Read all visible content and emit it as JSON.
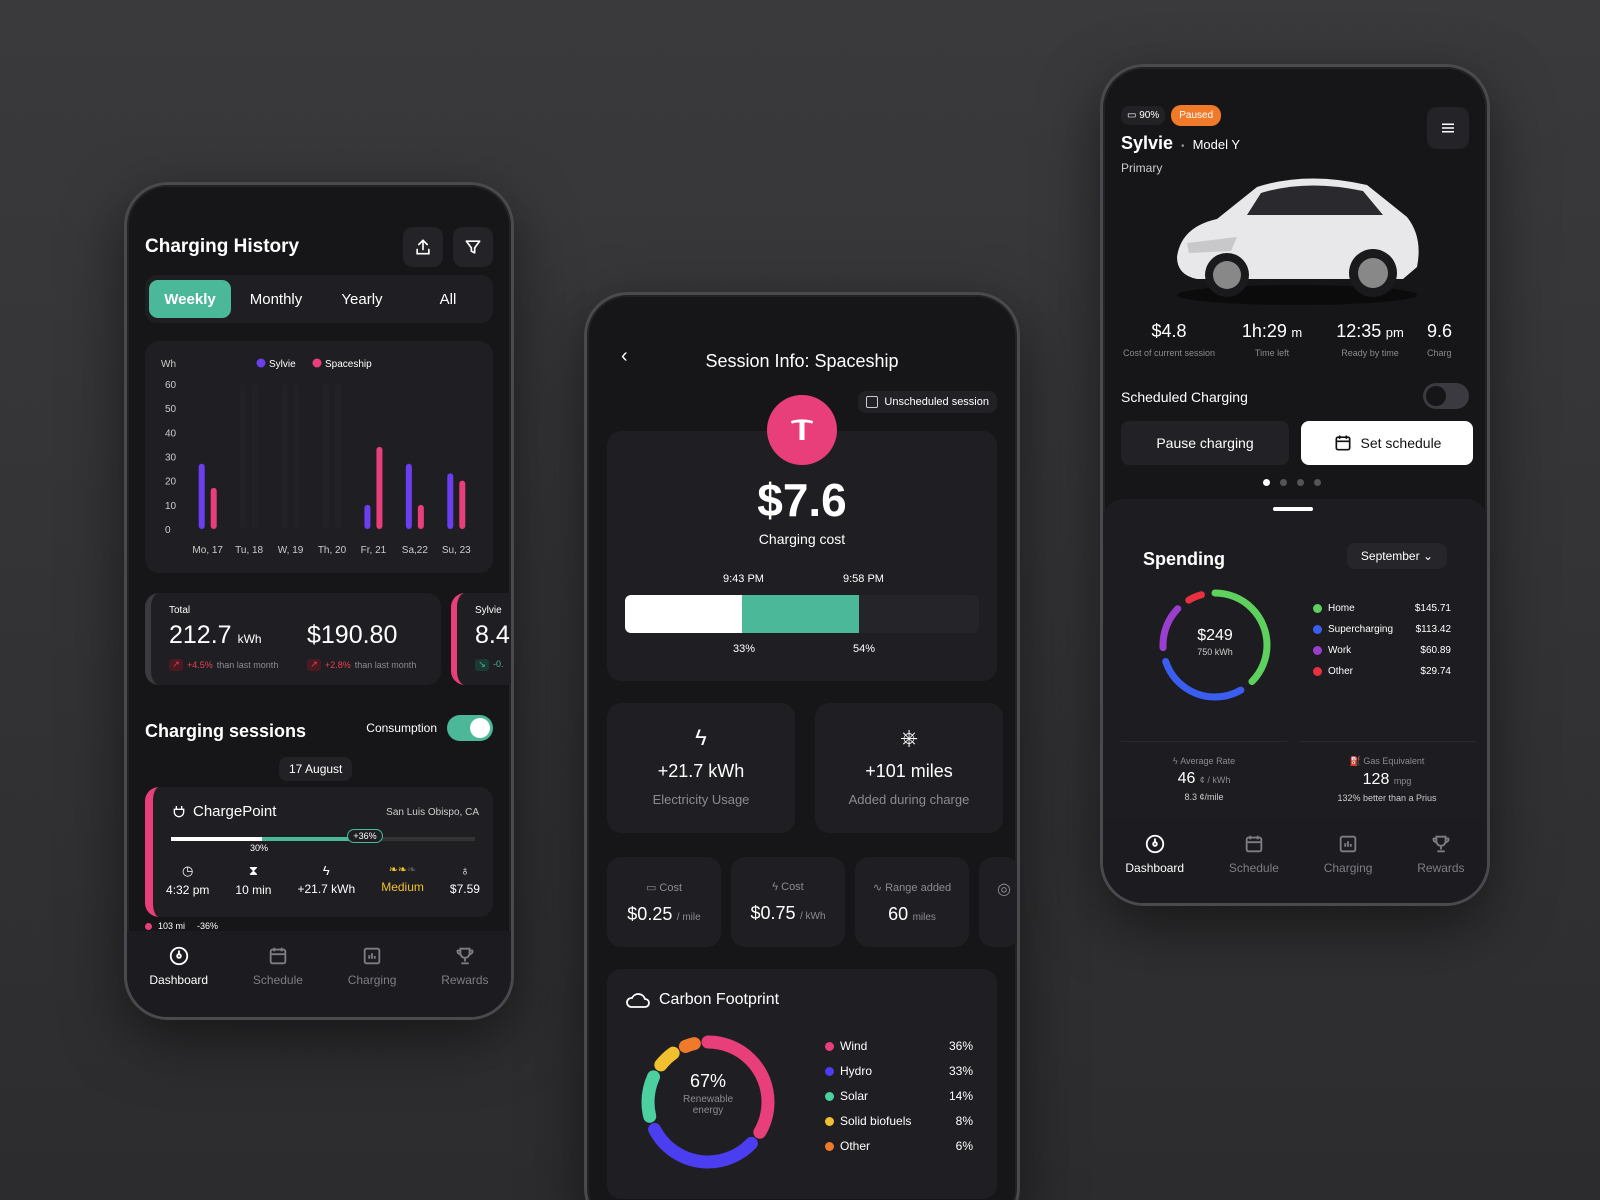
{
  "colors": {
    "accent": "#4cb89a",
    "pink": "#e83e7a",
    "purple": "#6b3ef0",
    "orange": "#f07a2a",
    "bg": "#161618"
  },
  "left": {
    "title": "Charging History",
    "tabs": [
      "Weekly",
      "Monthly",
      "Yearly",
      "All"
    ],
    "chart_data": {
      "type": "bar",
      "unit_label": "Wh",
      "legend": [
        "Sylvie",
        "Spaceship"
      ],
      "y_ticks": [
        "60",
        "50",
        "40",
        "30",
        "20",
        "10",
        "0"
      ],
      "categories": [
        "Mo, 17",
        "Tu, 18",
        "W, 19",
        "Th, 20",
        "Fr, 21",
        "Sa,22",
        "Su, 23"
      ],
      "ylim": [
        0,
        60
      ],
      "series": [
        {
          "name": "Sylvie",
          "color": "#6b3ef0",
          "values": [
            27,
            0,
            0,
            0,
            10,
            27,
            23
          ]
        },
        {
          "name": "Spaceship",
          "color": "#e83e7a",
          "values": [
            17,
            0,
            0,
            0,
            34,
            10,
            20
          ]
        }
      ]
    },
    "stats": {
      "total_label": "Total",
      "kwh": "212.7",
      "kwh_unit": "kWh",
      "kwh_change": "+4.5%",
      "kwh_change_text": "than last month",
      "cost": "$190.80",
      "cost_change": "+2.8%",
      "cost_change_text": "than last month",
      "side_label": "Sylvie",
      "side_value": "8.4",
      "side_change": "-0."
    },
    "sessions_title": "Charging sessions",
    "consumption_label": "Consumption",
    "date_chip": "17 August",
    "session": {
      "name": "ChargePoint",
      "location": "San Luis Obispo, CA",
      "progress_start_label": "30%",
      "progress_badge": "+36%",
      "progress_start": 0.3,
      "progress_end": 0.66,
      "time": "4:32 pm",
      "duration": "10 min",
      "energy": "+21.7 kWh",
      "level": "Medium",
      "cost": "$7.59"
    },
    "footer": {
      "miles": "103 mi",
      "pct": "-36%"
    },
    "nav": [
      "Dashboard",
      "Schedule",
      "Charging",
      "Rewards"
    ]
  },
  "middle": {
    "title": "Session Info: Spaceship",
    "chip": "Unscheduled session",
    "cost": "$7.6",
    "cost_label": "Charging cost",
    "time_start": "9:43 PM",
    "time_end": "9:58 PM",
    "pct_start": "33%",
    "pct_end": "54%",
    "usage": {
      "value": "+21.7 kWh",
      "label": "Electricity Usage"
    },
    "miles": {
      "value": "+101 miles",
      "label": "Added during charge"
    },
    "mini": [
      {
        "label": "Cost",
        "value": "$0.25",
        "unit": "/ mile"
      },
      {
        "label": "Cost",
        "value": "$0.75",
        "unit": "/ kWh"
      },
      {
        "label": "Range added",
        "value": "60",
        "unit": "miles"
      }
    ],
    "carbon": {
      "title": "Carbon Footprint",
      "center_value": "67%",
      "center_label": "Renewable energy",
      "items": [
        {
          "name": "Wind",
          "pct": "36%",
          "color": "#e83e7a",
          "value": 36
        },
        {
          "name": "Hydro",
          "pct": "33%",
          "color": "#4a3ef0",
          "value": 33
        },
        {
          "name": "Solar",
          "pct": "14%",
          "color": "#4cd0a0",
          "value": 14
        },
        {
          "name": "Solid biofuels",
          "pct": "8%",
          "color": "#f0c030",
          "value": 8
        },
        {
          "name": "Other",
          "pct": "6%",
          "color": "#f07a2a",
          "value": 6
        }
      ]
    }
  },
  "right": {
    "battery": "90%",
    "status": "Paused",
    "car_name": "Sylvie",
    "model": "Model Y",
    "role": "Primary",
    "stats": [
      {
        "value": "$4.8",
        "unit": "",
        "label": "Cost of current session"
      },
      {
        "value": "1h:29",
        "unit": "m",
        "label": "Time left"
      },
      {
        "value": "12:35",
        "unit": "pm",
        "label": "Ready by time"
      },
      {
        "value": "9.6",
        "unit": "",
        "label": "Charg"
      }
    ],
    "scheduled_label": "Scheduled Charging",
    "pause_label": "Pause charging",
    "schedule_label": "Set schedule",
    "spending_title": "Spending",
    "month": "September",
    "total": "$249",
    "total_kwh": "750 kWh",
    "spend": [
      {
        "name": "Home",
        "value": "$145.71",
        "color": "#5ed05e",
        "amount": 145.71
      },
      {
        "name": "Supercharging",
        "value": "$113.42",
        "color": "#3a5ef0",
        "amount": 113.42
      },
      {
        "name": "Work",
        "value": "$60.89",
        "color": "#9a3ed0",
        "amount": 60.89
      },
      {
        "name": "Other",
        "value": "$29.74",
        "color": "#e83040",
        "amount": 29.74
      }
    ],
    "rate": {
      "label": "Average Rate",
      "value": "46",
      "unit": "¢ / kWh",
      "sub": "8.3 ¢/mile"
    },
    "gas": {
      "label": "Gas Equivalent",
      "value": "128",
      "unit": "mpg",
      "sub": "132% better than a Prius"
    },
    "nav": [
      "Dashboard",
      "Schedule",
      "Charging",
      "Rewards"
    ]
  }
}
